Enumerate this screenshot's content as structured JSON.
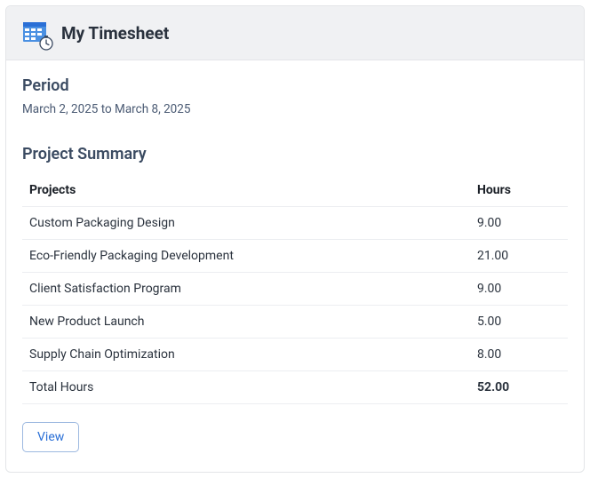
{
  "header": {
    "title": "My Timesheet"
  },
  "period": {
    "label": "Period",
    "range": "March 2, 2025 to March 8, 2025"
  },
  "summary": {
    "heading": "Project Summary",
    "columns": {
      "projects": "Projects",
      "hours": "Hours"
    },
    "rows": [
      {
        "project": "Custom Packaging Design",
        "hours": "9.00"
      },
      {
        "project": "Eco-Friendly Packaging Development",
        "hours": "21.00"
      },
      {
        "project": "Client Satisfaction Program",
        "hours": "9.00"
      },
      {
        "project": "New Product Launch",
        "hours": "5.00"
      },
      {
        "project": "Supply Chain Optimization",
        "hours": "8.00"
      }
    ],
    "total": {
      "label": "Total Hours",
      "value": "52.00"
    }
  },
  "actions": {
    "view": "View"
  },
  "colors": {
    "accent": "#2a6fd6",
    "heading": "#3a4a61"
  }
}
